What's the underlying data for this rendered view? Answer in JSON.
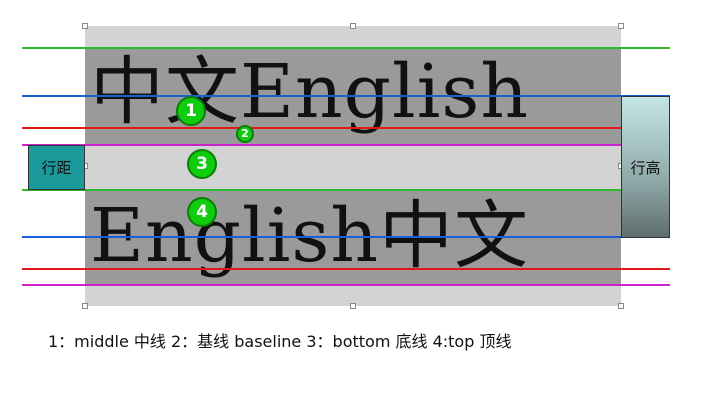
{
  "sample_lines": {
    "line1": "中文English",
    "line2": "English中文"
  },
  "labels": {
    "line_spacing": "行距",
    "line_height": "行高"
  },
  "markers": [
    "1",
    "2",
    "3",
    "4"
  ],
  "caption": "1：middle 中线  2：基线 baseline  3：bottom 底线   4:top 顶线",
  "colors": {
    "top_line": "#2db82d",
    "middle_line": "#1a5fd6",
    "baseline": "#e01818",
    "bottom_line": "#cc22cc",
    "marker_fill": "#0fcc0f",
    "background_box": "#d3d3d3",
    "text_band": "#9a9a9a",
    "line_spacing_box": "#1a9a9a"
  }
}
